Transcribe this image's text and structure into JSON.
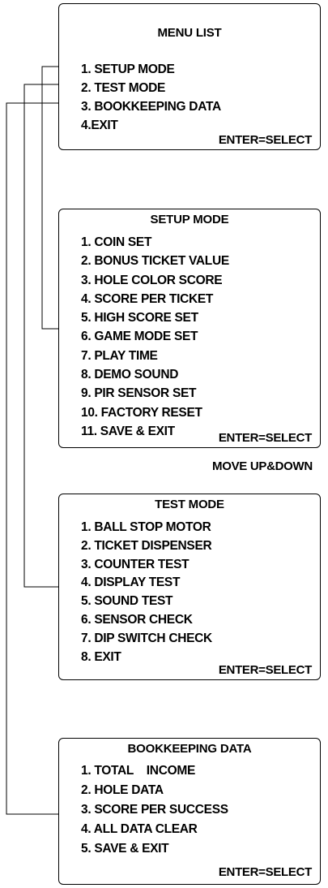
{
  "menu_list": {
    "title": "MENU LIST",
    "items": [
      "1. SETUP MODE",
      "2. TEST MODE",
      "3. BOOKKEEPING DATA",
      "4.EXIT"
    ],
    "footer": "ENTER=SELECT"
  },
  "setup_mode": {
    "title": "SETUP MODE",
    "items": [
      "1. COIN SET",
      "2. BONUS TICKET VALUE",
      "3. HOLE COLOR SCORE",
      "4. SCORE PER TICKET",
      "5. HIGH SCORE SET",
      "6. GAME MODE SET",
      "7. PLAY TIME",
      "8. DEMO SOUND",
      "9. PIR SENSOR SET",
      "10. FACTORY RESET",
      "11. SAVE & EXIT"
    ],
    "footer": "ENTER=SELECT",
    "note": "MOVE UP&DOWN"
  },
  "test_mode": {
    "title": "TEST MODE",
    "items": [
      "1. BALL STOP MOTOR",
      "2. TICKET DISPENSER",
      "3. COUNTER TEST",
      "4. DISPLAY TEST",
      "5. SOUND TEST",
      "6. SENSOR CHECK",
      "7. DIP SWITCH CHECK",
      "8. EXIT"
    ],
    "footer": "ENTER=SELECT"
  },
  "bookkeeping_data": {
    "title": "BOOKKEEPING DATA",
    "items": [
      "1. TOTAL    INCOME",
      "2. HOLE DATA",
      "3. SCORE PER SUCCESS",
      "4. ALL DATA CLEAR",
      "5. SAVE & EXIT"
    ],
    "footer": "ENTER=SELECT"
  }
}
